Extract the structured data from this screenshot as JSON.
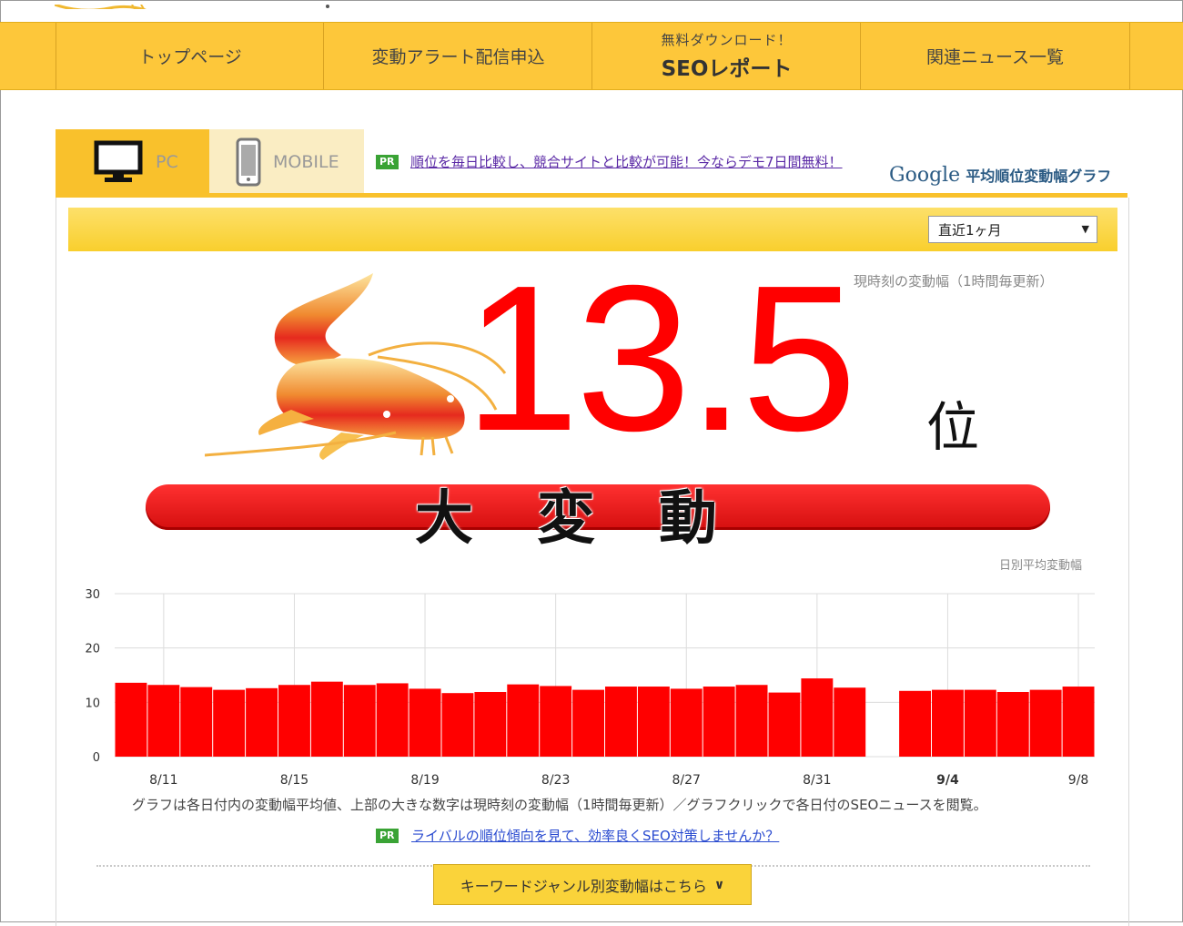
{
  "nav": {
    "items": [
      {
        "label": "トップページ"
      },
      {
        "label": "変動アラート配信申込"
      },
      {
        "small": "無料ダウンロード！",
        "big": "SEOレポート"
      },
      {
        "label": "関連ニュース一覧"
      }
    ]
  },
  "tabs": {
    "pc": "PC",
    "mobile": "MOBILE"
  },
  "pr_badge": "PR",
  "promo_link": "順位を毎日比較し、競合サイトと比較が可能！今ならデモ7日間無料！",
  "graph_title": {
    "google": "Google",
    "text": "平均順位変動幅グラフ"
  },
  "period": {
    "selected": "直近1ヶ月"
  },
  "current": {
    "label": "現時刻の変動幅（1時間毎更新）",
    "value": "13.5",
    "unit": "位",
    "status": "大変動"
  },
  "chart_title": "日別平均変動幅",
  "chart_data": {
    "type": "bar",
    "categories": [
      "8/10",
      "8/11",
      "8/12",
      "8/13",
      "8/14",
      "8/15",
      "8/16",
      "8/17",
      "8/18",
      "8/19",
      "8/20",
      "8/21",
      "8/22",
      "8/23",
      "8/24",
      "8/25",
      "8/26",
      "8/27",
      "8/28",
      "8/29",
      "8/30",
      "8/31",
      "9/1",
      "9/2",
      "9/3",
      "9/4",
      "9/5",
      "9/6",
      "9/7",
      "9/8"
    ],
    "values": [
      13.6,
      13.2,
      12.8,
      12.3,
      12.6,
      13.2,
      13.8,
      13.2,
      13.5,
      12.5,
      11.7,
      11.9,
      13.3,
      13.0,
      12.3,
      12.9,
      12.9,
      12.5,
      12.9,
      13.2,
      11.8,
      14.4,
      12.7,
      null,
      12.1,
      12.3,
      12.3,
      11.9,
      12.3,
      12.9
    ],
    "x_tick_labels": [
      "8/11",
      "8/15",
      "8/19",
      "8/23",
      "8/27",
      "8/31",
      "9/4",
      "9/8"
    ],
    "highlight_tick": "9/4",
    "y_ticks": [
      0,
      10,
      20,
      30
    ],
    "ylim": [
      0,
      30
    ],
    "color": "#ff0000",
    "grid": true
  },
  "note": "グラフは各日付内の変動幅平均値、上部の大きな数字は現時刻の変動幅（1時間毎更新）／グラフクリックで各日付のSEOニュースを閲覧。",
  "rival_link": "ライバルの順位傾向を見て、効率良くSEO対策しませんか？",
  "genre_button": "キーワードジャンル別変動幅はこちら",
  "colors": {
    "nav_bg": "#fdc73a",
    "accent_red": "#ff0000",
    "pr_green": "#3aa335",
    "google_blue": "#2b5b84"
  }
}
